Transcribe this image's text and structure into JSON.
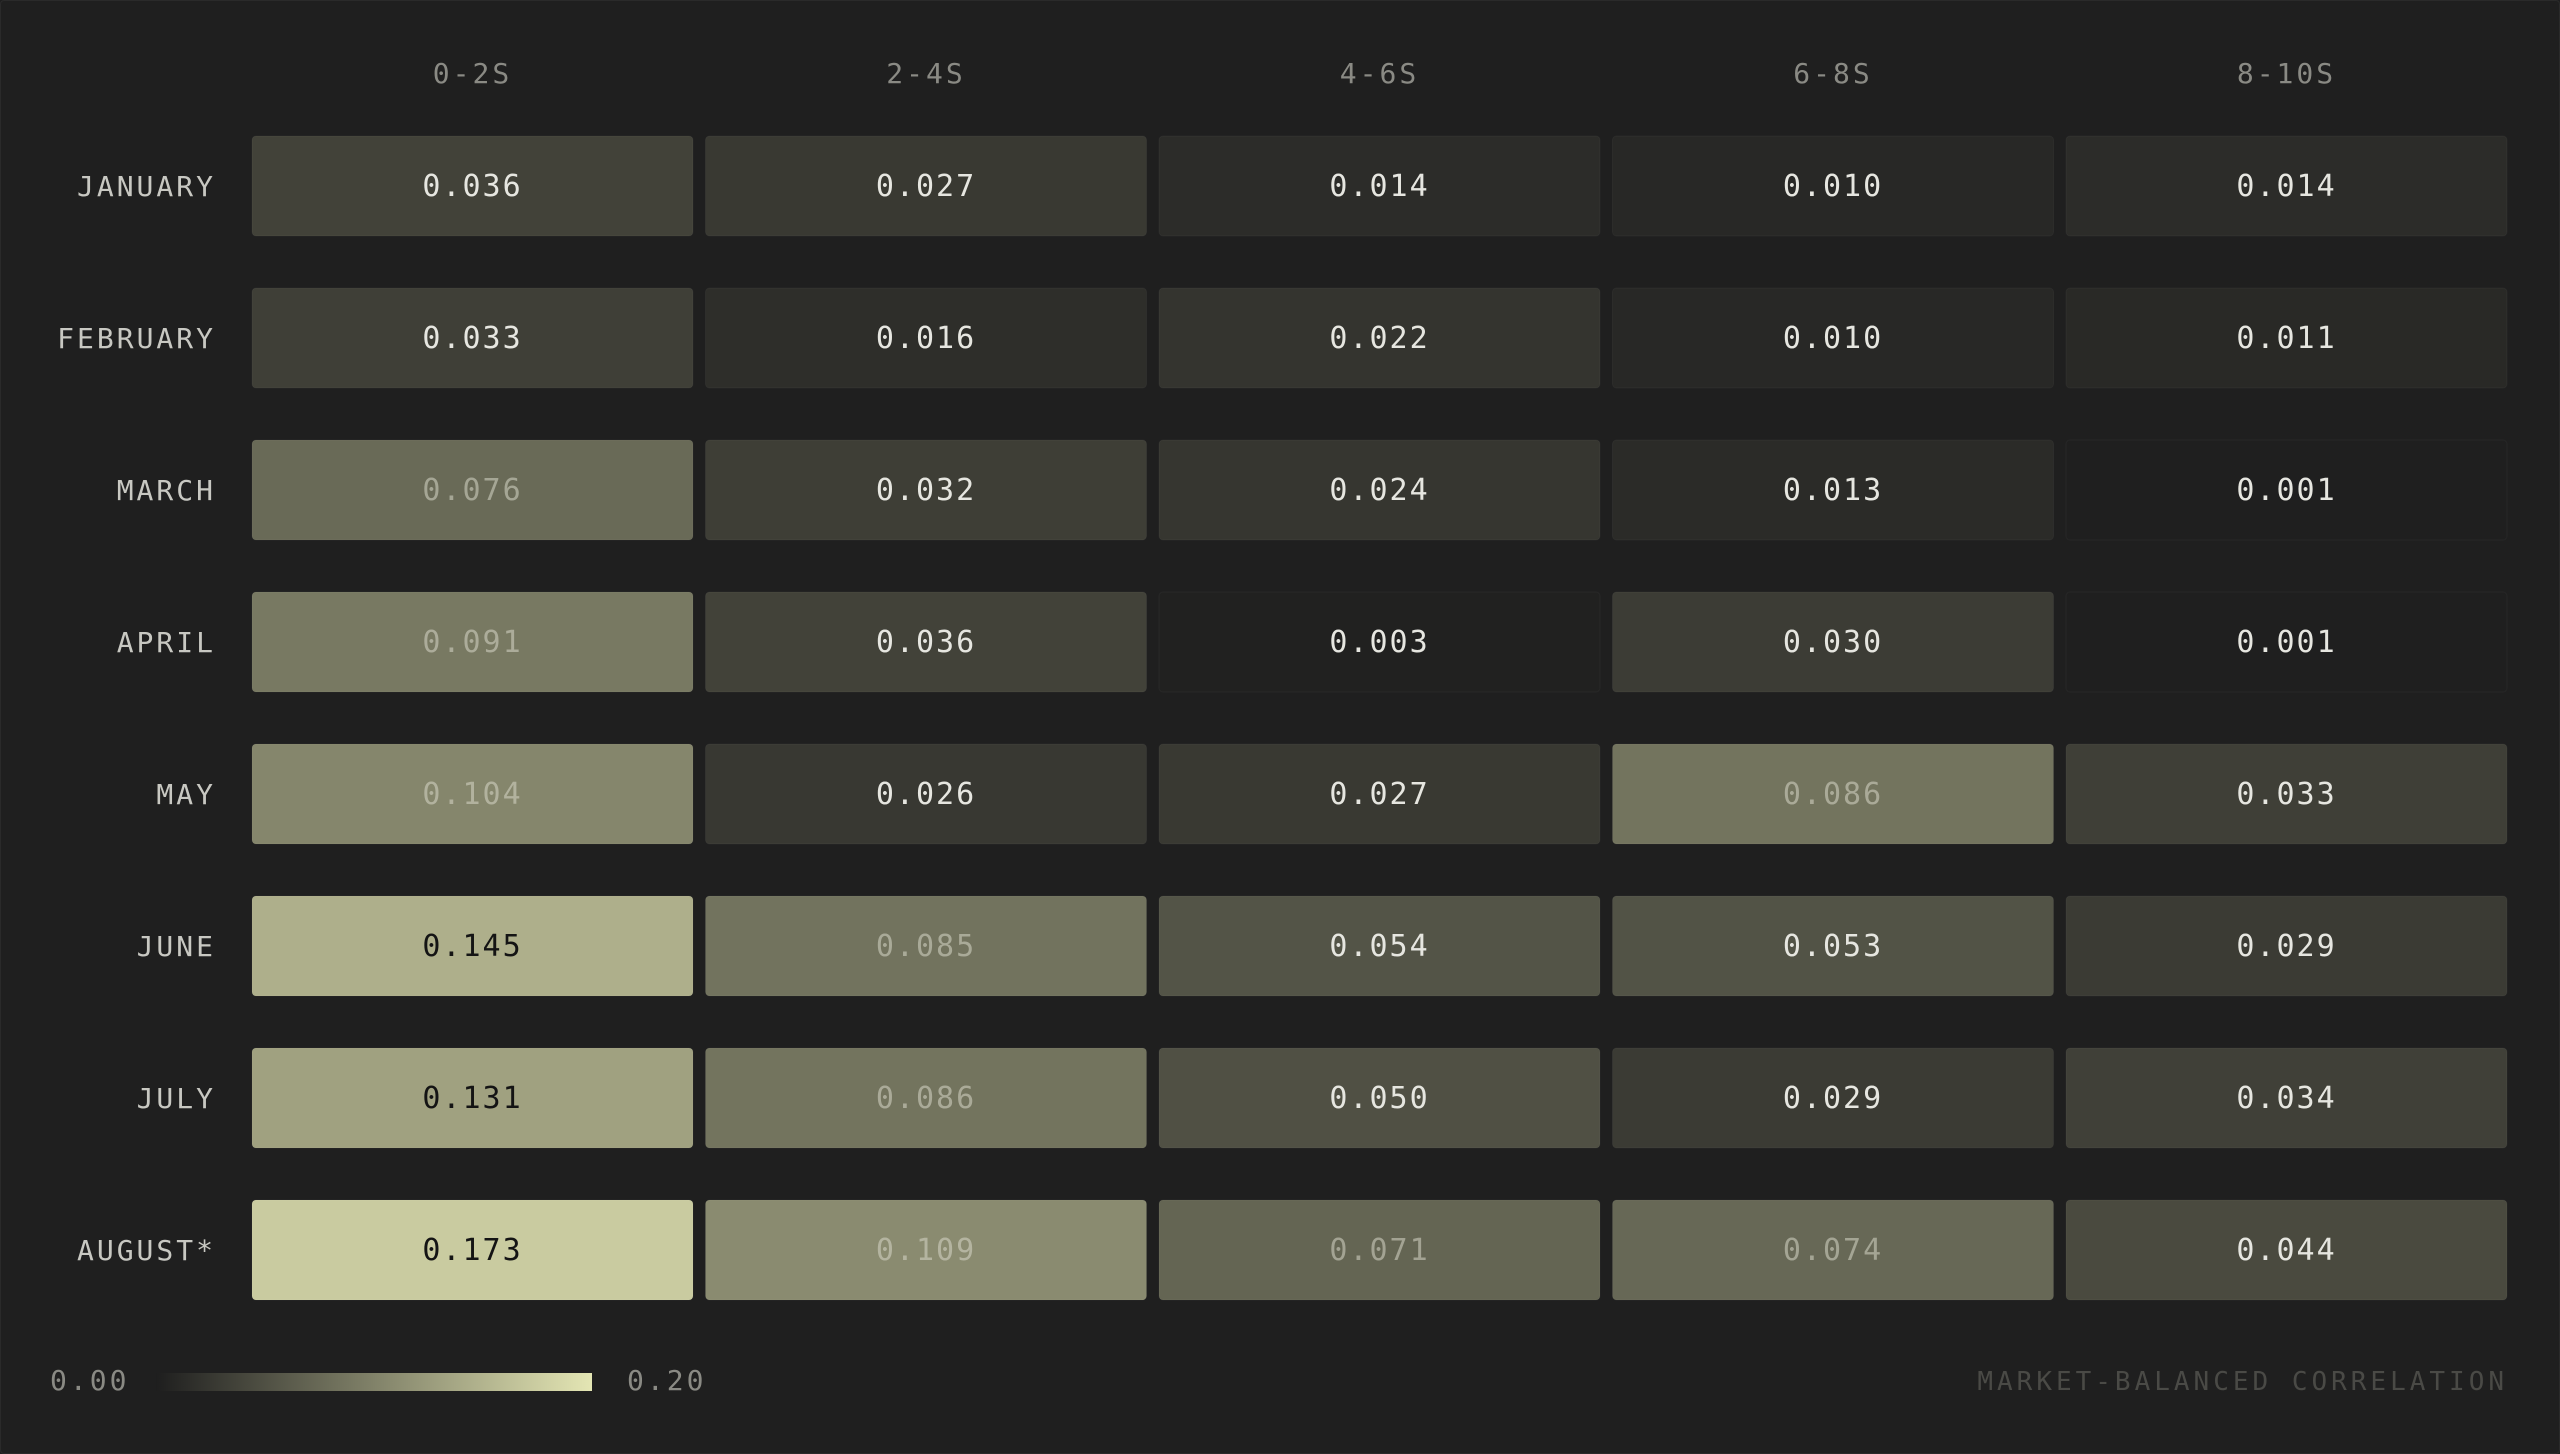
{
  "chart_data": {
    "type": "heatmap",
    "title": "",
    "columns": [
      "0-2S",
      "2-4S",
      "4-6S",
      "6-8S",
      "8-10S"
    ],
    "rows": [
      "JANUARY",
      "FEBRUARY",
      "MARCH",
      "APRIL",
      "MAY",
      "JUNE",
      "JULY",
      "AUGUST*"
    ],
    "values": [
      [
        0.036,
        0.027,
        0.014,
        0.01,
        0.014
      ],
      [
        0.033,
        0.016,
        0.022,
        0.01,
        0.011
      ],
      [
        0.076,
        0.032,
        0.024,
        0.013,
        0.001
      ],
      [
        0.091,
        0.036,
        0.003,
        0.03,
        0.001
      ],
      [
        0.104,
        0.026,
        0.027,
        0.086,
        0.033
      ],
      [
        0.145,
        0.085,
        0.054,
        0.053,
        0.029
      ],
      [
        0.131,
        0.086,
        0.05,
        0.029,
        0.034
      ],
      [
        0.173,
        0.109,
        0.071,
        0.074,
        0.044
      ]
    ],
    "scale": {
      "min": 0.0,
      "max": 0.2,
      "min_label": "0.00",
      "max_label": "0.20",
      "color_low": "#1e1e1e",
      "color_high": "#e4e6b4"
    },
    "caption": "MARKET-BALANCED CORRELATION"
  },
  "colors": {
    "background": "#1f1f1f",
    "text_light": "#e6e6e0",
    "text_dark": "#141414",
    "column_label": "#8a8a84",
    "row_label": "#c8c8c2",
    "caption": "#4a4a46"
  }
}
